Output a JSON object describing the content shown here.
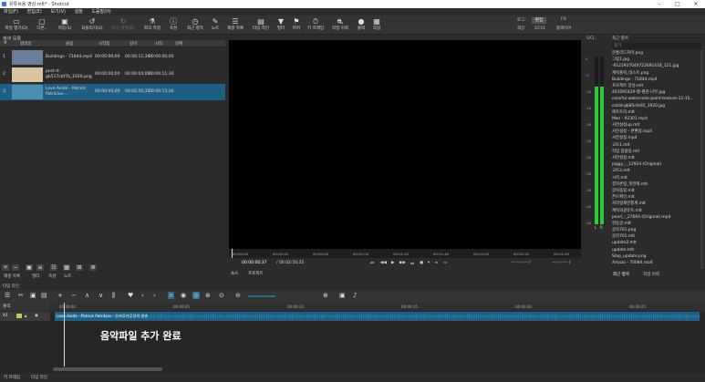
{
  "window": {
    "title": "유튜브용 영상.mlt* - Shotcut"
  },
  "menu": [
    "파일(F)",
    "편집(E)",
    "보기(V)",
    "설정",
    "도움말(H)"
  ],
  "toolbar": [
    {
      "icon": "open-file-icon",
      "label": "파일 열기(O)",
      "enabled": true
    },
    {
      "icon": "other-icon",
      "label": "다른..",
      "enabled": true
    },
    {
      "icon": "save-icon",
      "label": "저장(S)",
      "enabled": true
    },
    {
      "icon": "undo-icon",
      "label": "되돌리기(U)",
      "enabled": true
    },
    {
      "icon": "redo-icon",
      "label": "다시 실행(R)",
      "enabled": false
    },
    {
      "icon": "peak-meter-icon",
      "label": "피크 측정",
      "enabled": true
    },
    {
      "icon": "properties-icon",
      "label": "속성",
      "enabled": true
    },
    {
      "icon": "recent-icon",
      "label": "최근 항목",
      "enabled": true
    },
    {
      "icon": "notes-icon",
      "label": "노트",
      "enabled": true
    },
    {
      "icon": "playlist-icon",
      "label": "재생 목록",
      "enabled": true
    },
    {
      "icon": "timeline-icon",
      "label": "타임 라인",
      "enabled": true
    },
    {
      "icon": "filter-icon",
      "label": "필터",
      "enabled": true
    },
    {
      "icon": "marker-icon",
      "label": "마커",
      "enabled": true
    },
    {
      "icon": "keyframes-icon",
      "label": "키 프레임",
      "enabled": true
    },
    {
      "icon": "jobs-icon",
      "label": "작업 이력",
      "enabled": true
    },
    {
      "icon": "export-icon",
      "label": "출력",
      "enabled": true
    },
    {
      "icon": "jobs-queue-icon",
      "label": "작업",
      "enabled": true
    }
  ],
  "layouts": {
    "top": [
      "로그",
      "편집",
      "FX"
    ],
    "bottom": [
      "색상",
      "오디오",
      "플레이어"
    ]
  },
  "playlist": {
    "title": "재생 목록",
    "columns": [
      "#",
      "썸네일",
      "클립",
      "시작점",
      "길이",
      "시작",
      "날짜"
    ],
    "rows": [
      {
        "num": "1",
        "clip": "Buildings - 71844.mp4",
        "in": "00:00:00;00",
        "duration": "00:00:11;30",
        "start": "00:00:00;00",
        "selected": false,
        "thumb": "#6a7e9a"
      },
      {
        "num": "2",
        "clip": "post-it-gb517cbf7b_1920.png",
        "in": "00:00:00;00",
        "duration": "00:00:04;00",
        "start": "00:00:11;30",
        "selected": false,
        "thumb": "#d9c5a0"
      },
      {
        "num": "3",
        "clip": "Love Aside - Patrick Patrikios-...",
        "in": "00:00:00;00",
        "duration": "00:02:50;35",
        "start": "00:00:15;30",
        "selected": true,
        "thumb": "#4a8fb0"
      }
    ],
    "bottom_tabs": [
      "재생 목록",
      "필터",
      "속성",
      "노트"
    ]
  },
  "viewer": {
    "ruler_ticks": [
      "00:00:00",
      "00:00:20",
      "00:00:40",
      "00:01:00",
      "00:01:20",
      "00:01:40",
      "00:02:00",
      "00:02:20",
      "00:02:40"
    ],
    "timecode": "00:00:00;37",
    "duration": "/ 00:02:50;35",
    "in_out": "--:--:--:-- /",
    "tabs": [
      "소스",
      "프로젝트"
    ]
  },
  "meter": {
    "title": "오디..",
    "scale": [
      "0",
      "-5",
      "-10",
      "-15",
      "-20",
      "-25",
      "-30",
      "-35",
      "-40",
      "-45",
      "-50"
    ],
    "channels": [
      "L",
      "R"
    ],
    "level": 0.82
  },
  "recent": {
    "title": "최근 항목",
    "search_placeholder": "찾기",
    "items": [
      "분홍리드차이.png",
      "그림1.jpg",
      "-6122937049722691418_121.jpg",
      "캐릭플릭_대스트.png",
      "Buildings - 71844.mp4",
      "프로젝트 양성.mlt",
      "401095429-펭-펭귄-나무.jpg",
      "colorful-watercolor-paint-texture-11-15..",
      "colild-gb85cfe92_1920.jpg",
      "애프트리.mlt",
      "Man - 92301.mp4",
      "사연설정up.mlt",
      "사진설정 - 변환됨.mp4",
      "사연설정.mp4",
      "교토1.mlt",
      "작업 험플링.mlt",
      "사연설정.mlt",
      "piggy_-_12924 (Original)",
      "교토2.mlt",
      "시작.mlt",
      "결자론링_폭연제.mlt",
      "글자동링.mlt",
      "폰트확인.mlt",
      "자막링제한통계.mlt",
      "캐릭의광유트.mlt",
      "pond_-_27664 (Original).mp4",
      "현동글.mlt",
      "글자701.png",
      "글자701.mlt",
      "update2.mlt",
      "update.mlt",
      "Stop_update.png",
      "Amazo - 70084.mp4"
    ],
    "tabs": [
      "최근 항목",
      "작업 이력"
    ]
  },
  "timeline": {
    "title": "타임 라인",
    "track_name": "출력",
    "track_label": "A1",
    "ticks": [
      "00:00:00",
      "00:00:05",
      "00:00:10",
      "00:00:15",
      "00:00:20",
      "00:00:25"
    ],
    "clip_label": "Love Aside - Patrick Patrikios - 은자루가무루의 맞춘",
    "caption": "음악파일 추가 완료"
  },
  "status": {
    "tabs": [
      "키 프레임",
      "타임 라인"
    ]
  },
  "colors": {
    "accent": "#2d6b8a",
    "selected": "#1f5f85",
    "meter_green": "#2ec93a",
    "audio_wave": "#2a7fae"
  }
}
